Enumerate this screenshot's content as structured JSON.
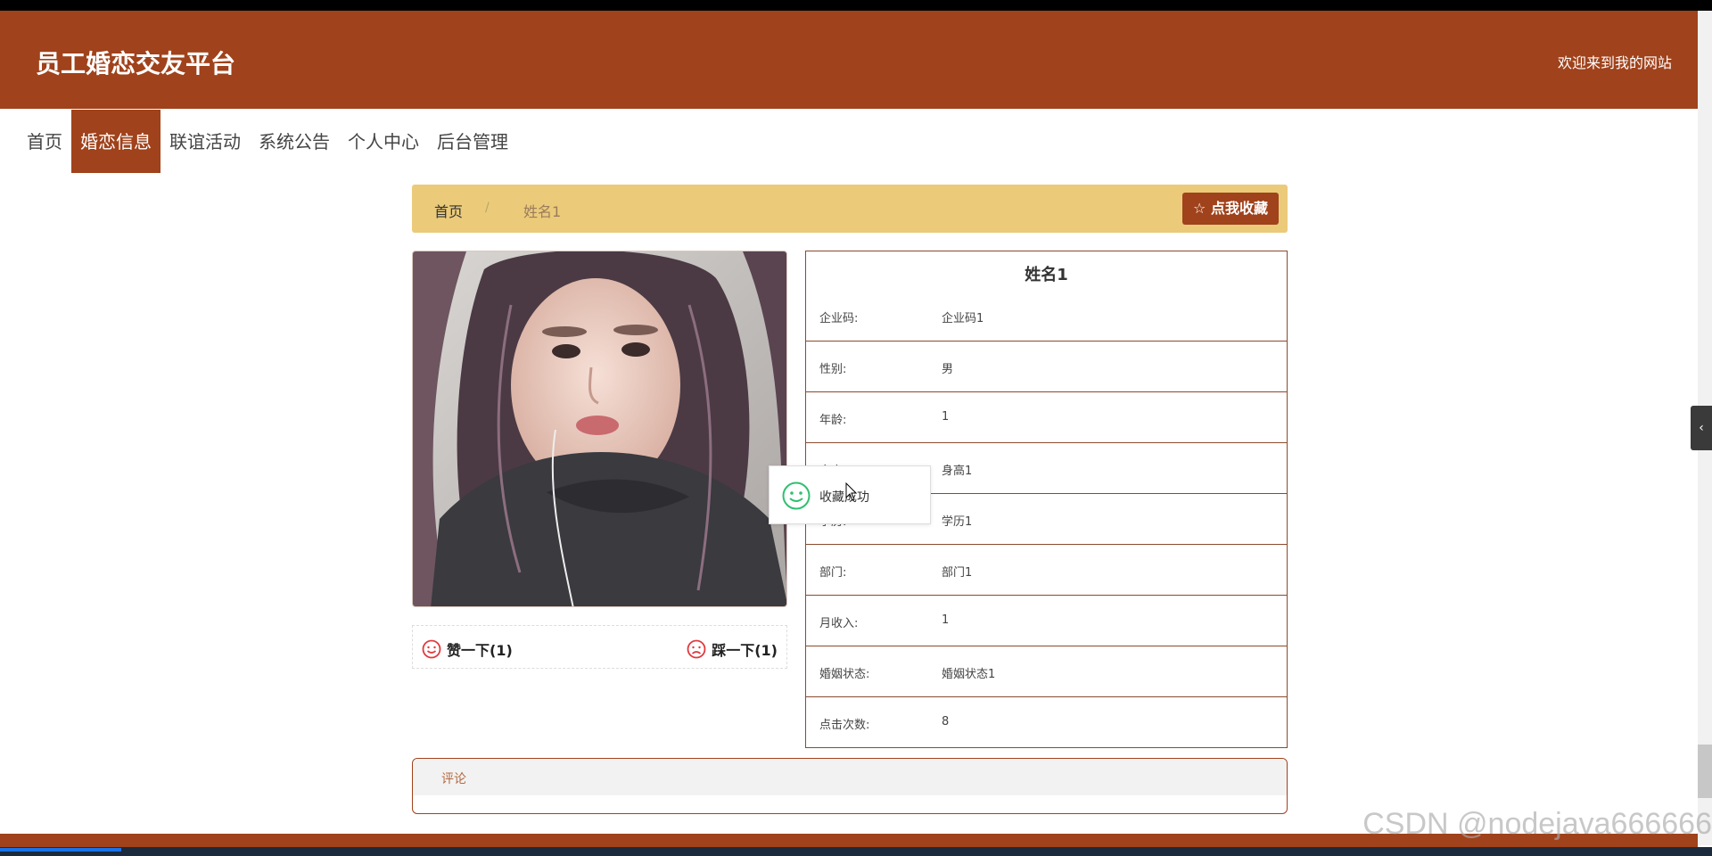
{
  "header": {
    "site_title": "员工婚恋交友平台",
    "welcome": "欢迎来到我的网站"
  },
  "nav": {
    "items": [
      "首页",
      "婚恋信息",
      "联谊活动",
      "系统公告",
      "个人中心",
      "后台管理"
    ],
    "active_index": 1
  },
  "breadcrumb": {
    "home": "首页",
    "separator": "/",
    "current": "姓名1"
  },
  "favorite_button": {
    "icon": "star-outline-icon",
    "label": "☆ 点我收藏"
  },
  "votes": {
    "up_label": "赞一下(1)",
    "down_label": "踩一下(1)"
  },
  "profile": {
    "title": "姓名1",
    "rows": [
      {
        "label": "企业码:",
        "value": "企业码1"
      },
      {
        "label": "性别:",
        "value": "男"
      },
      {
        "label": "年龄:",
        "value": "1"
      },
      {
        "label": "身高:",
        "value": "身高1"
      },
      {
        "label": "学历:",
        "value": "学历1"
      },
      {
        "label": "部门:",
        "value": "部门1"
      },
      {
        "label": "月收入:",
        "value": "1"
      },
      {
        "label": "婚姻状态:",
        "value": "婚姻状态1"
      },
      {
        "label": "点击次数:",
        "value": "8"
      }
    ]
  },
  "toast": {
    "icon": "smile-icon",
    "text": "收藏成功"
  },
  "comments": {
    "header": "评论"
  },
  "watermark": "CSDN @nodejava666666",
  "colors": {
    "brand": "#a0421b",
    "breadcrumb_bg": "#ebcb7a",
    "toast_icon": "#2fbf71",
    "vote_icon": "#e0393e"
  }
}
